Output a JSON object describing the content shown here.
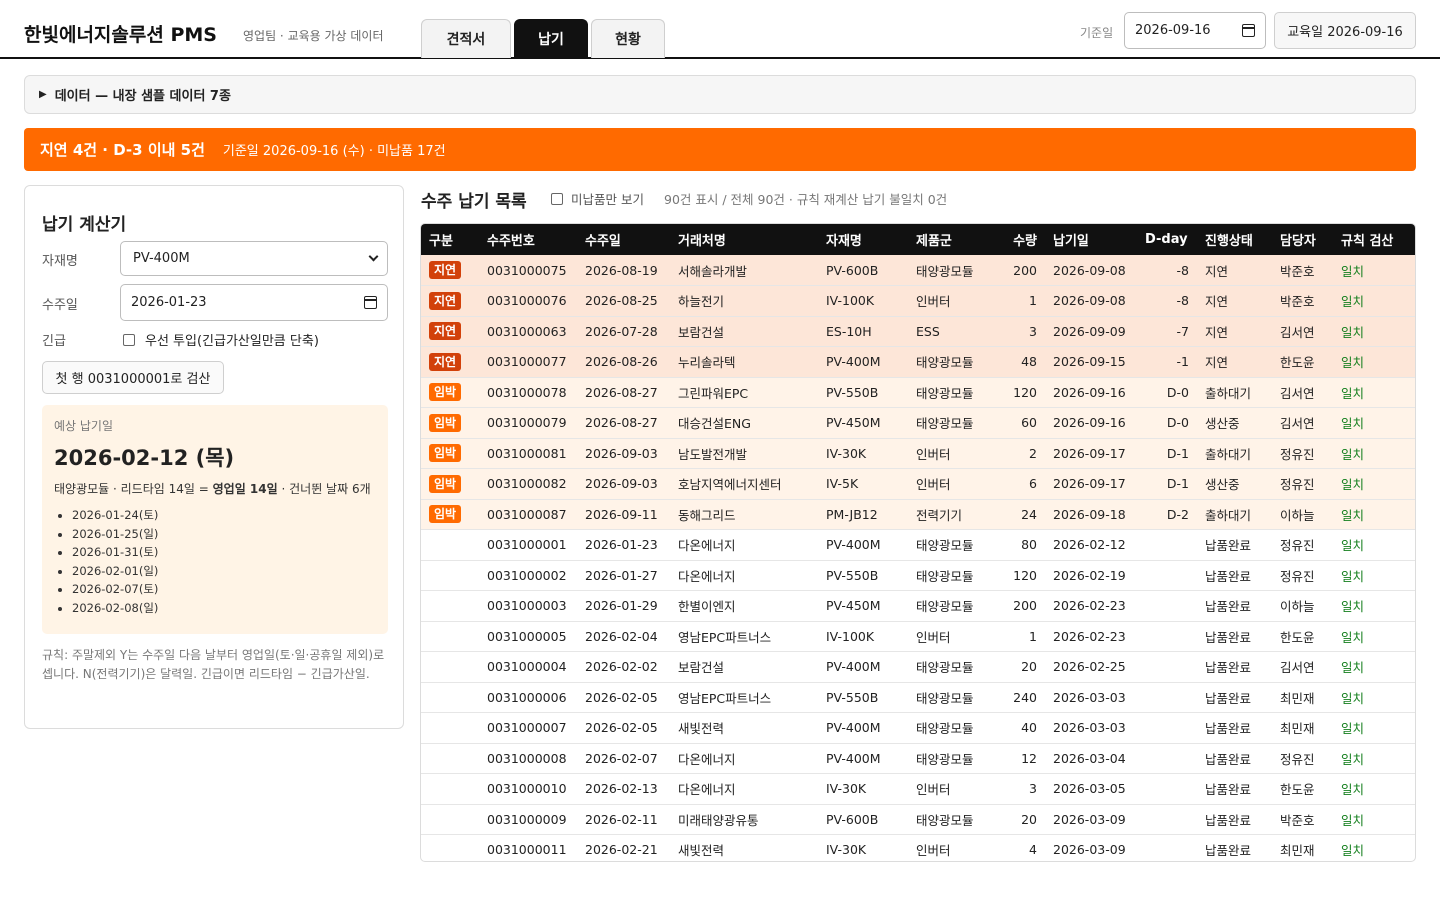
{
  "header": {
    "brand": "한빛에너지솔루션 PMS",
    "subtitle": "영업팀 · 교육용 가상 데이터",
    "tabs": [
      {
        "label": "견적서",
        "active": false
      },
      {
        "label": "납기",
        "active": true
      },
      {
        "label": "현황",
        "active": false
      }
    ],
    "base_date_label": "기준일",
    "base_date_value": "2026-09-16",
    "edu_date_button": "교육일 2026-09-16"
  },
  "data_section": {
    "label": "데이터 — 내장 샘플 데이터 7종"
  },
  "alert": {
    "main": "지연 4건 · D-3 이내 5건",
    "sub": "기준일 2026-09-16 (수) · 미납품 17건",
    "color": "#ff6a00"
  },
  "calculator": {
    "title": "납기 계산기",
    "material_label": "자재명",
    "material_value": "PV-400M",
    "order_date_label": "수주일",
    "order_date_value": "2026-01-23",
    "urgent_label": "긴급",
    "urgent_checkbox_label": "우선 투입(긴급가산일만큼 단축)",
    "check_button": "첫 행 0031000001로 검산",
    "result_label": "예상 납기일",
    "result_date": "2026-02-12 (목)",
    "result_desc_prefix": "태양광모듈 · 리드타임 14일 = ",
    "result_desc_bold": "영업일 14일",
    "result_desc_suffix": " · 건너뛴 날짜 6개",
    "skipped_dates": [
      "2026-01-24(토)",
      "2026-01-25(일)",
      "2026-01-31(토)",
      "2026-02-01(일)",
      "2026-02-07(토)",
      "2026-02-08(일)"
    ],
    "rule_text": "규칙: 주말제외 Y는 수주일 다음 날부터 영업일(토·일·공휴일 제외)로 셉니다. N(전력기기)은 달력일. 긴급이면 리드타임 − 긴급가산일."
  },
  "list": {
    "title": "수주 납기 목록",
    "filter_label": "미납품만 보기",
    "summary": "90건 표시 / 전체 90건 · 규칙 재계산 납기 불일치 0건",
    "columns": [
      "구분",
      "수주번호",
      "수주일",
      "거래처명",
      "자재명",
      "제품군",
      "수량",
      "납기일",
      "D-day",
      "진행상태",
      "담당자",
      "규칙 검산"
    ],
    "rows": [
      {
        "type": "late",
        "badge": "지연",
        "no": "0031000075",
        "order_date": "2026-08-19",
        "client": "서해솔라개발",
        "material": "PV-600B",
        "group": "태양광모듈",
        "qty": "200",
        "due": "2026-09-08",
        "dday": "-8",
        "status": "지연",
        "owner": "박준호",
        "check": "일치"
      },
      {
        "type": "late",
        "badge": "지연",
        "no": "0031000076",
        "order_date": "2026-08-25",
        "client": "하늘전기",
        "material": "IV-100K",
        "group": "인버터",
        "qty": "1",
        "due": "2026-09-08",
        "dday": "-8",
        "status": "지연",
        "owner": "박준호",
        "check": "일치"
      },
      {
        "type": "late",
        "badge": "지연",
        "no": "0031000063",
        "order_date": "2026-07-28",
        "client": "보람건설",
        "material": "ES-10H",
        "group": "ESS",
        "qty": "3",
        "due": "2026-09-09",
        "dday": "-7",
        "status": "지연",
        "owner": "김서연",
        "check": "일치"
      },
      {
        "type": "late",
        "badge": "지연",
        "no": "0031000077",
        "order_date": "2026-08-26",
        "client": "누리솔라텍",
        "material": "PV-400M",
        "group": "태양광모듈",
        "qty": "48",
        "due": "2026-09-15",
        "dday": "-1",
        "status": "지연",
        "owner": "한도윤",
        "check": "일치"
      },
      {
        "type": "soon",
        "badge": "임박",
        "no": "0031000078",
        "order_date": "2026-08-27",
        "client": "그린파워EPC",
        "material": "PV-550B",
        "group": "태양광모듈",
        "qty": "120",
        "due": "2026-09-16",
        "dday": "D-0",
        "status": "출하대기",
        "owner": "김서연",
        "check": "일치"
      },
      {
        "type": "soon",
        "badge": "임박",
        "no": "0031000079",
        "order_date": "2026-08-27",
        "client": "대승건설ENG",
        "material": "PV-450M",
        "group": "태양광모듈",
        "qty": "60",
        "due": "2026-09-16",
        "dday": "D-0",
        "status": "생산중",
        "owner": "김서연",
        "check": "일치"
      },
      {
        "type": "soon",
        "badge": "임박",
        "no": "0031000081",
        "order_date": "2026-09-03",
        "client": "남도발전개발",
        "material": "IV-30K",
        "group": "인버터",
        "qty": "2",
        "due": "2026-09-17",
        "dday": "D-1",
        "status": "출하대기",
        "owner": "정유진",
        "check": "일치"
      },
      {
        "type": "soon",
        "badge": "임박",
        "no": "0031000082",
        "order_date": "2026-09-03",
        "client": "호남지역에너지센터",
        "material": "IV-5K",
        "group": "인버터",
        "qty": "6",
        "due": "2026-09-17",
        "dday": "D-1",
        "status": "생산중",
        "owner": "정유진",
        "check": "일치"
      },
      {
        "type": "soon",
        "badge": "임박",
        "no": "0031000087",
        "order_date": "2026-09-11",
        "client": "동해그리드",
        "material": "PM-JB12",
        "group": "전력기기",
        "qty": "24",
        "due": "2026-09-18",
        "dday": "D-2",
        "status": "출하대기",
        "owner": "이하늘",
        "check": "일치"
      },
      {
        "type": "done",
        "badge": "",
        "no": "0031000001",
        "order_date": "2026-01-23",
        "client": "다온에너지",
        "material": "PV-400M",
        "group": "태양광모듈",
        "qty": "80",
        "due": "2026-02-12",
        "dday": "",
        "status": "납품완료",
        "owner": "정유진",
        "check": "일치"
      },
      {
        "type": "done",
        "badge": "",
        "no": "0031000002",
        "order_date": "2026-01-27",
        "client": "다온에너지",
        "material": "PV-550B",
        "group": "태양광모듈",
        "qty": "120",
        "due": "2026-02-19",
        "dday": "",
        "status": "납품완료",
        "owner": "정유진",
        "check": "일치"
      },
      {
        "type": "done",
        "badge": "",
        "no": "0031000003",
        "order_date": "2026-01-29",
        "client": "한별이엔지",
        "material": "PV-450M",
        "group": "태양광모듈",
        "qty": "200",
        "due": "2026-02-23",
        "dday": "",
        "status": "납품완료",
        "owner": "이하늘",
        "check": "일치"
      },
      {
        "type": "done",
        "badge": "",
        "no": "0031000005",
        "order_date": "2026-02-04",
        "client": "영남EPC파트너스",
        "material": "IV-100K",
        "group": "인버터",
        "qty": "1",
        "due": "2026-02-23",
        "dday": "",
        "status": "납품완료",
        "owner": "한도윤",
        "check": "일치"
      },
      {
        "type": "done",
        "badge": "",
        "no": "0031000004",
        "order_date": "2026-02-02",
        "client": "보람건설",
        "material": "PV-400M",
        "group": "태양광모듈",
        "qty": "20",
        "due": "2026-02-25",
        "dday": "",
        "status": "납품완료",
        "owner": "김서연",
        "check": "일치"
      },
      {
        "type": "done",
        "badge": "",
        "no": "0031000006",
        "order_date": "2026-02-05",
        "client": "영남EPC파트너스",
        "material": "PV-550B",
        "group": "태양광모듈",
        "qty": "240",
        "due": "2026-03-03",
        "dday": "",
        "status": "납품완료",
        "owner": "최민재",
        "check": "일치"
      },
      {
        "type": "done",
        "badge": "",
        "no": "0031000007",
        "order_date": "2026-02-05",
        "client": "새빛전력",
        "material": "PV-400M",
        "group": "태양광모듈",
        "qty": "40",
        "due": "2026-03-03",
        "dday": "",
        "status": "납품완료",
        "owner": "최민재",
        "check": "일치"
      },
      {
        "type": "done",
        "badge": "",
        "no": "0031000008",
        "order_date": "2026-02-07",
        "client": "다온에너지",
        "material": "PV-400M",
        "group": "태양광모듈",
        "qty": "12",
        "due": "2026-03-04",
        "dday": "",
        "status": "납품완료",
        "owner": "정유진",
        "check": "일치"
      },
      {
        "type": "done",
        "badge": "",
        "no": "0031000010",
        "order_date": "2026-02-13",
        "client": "다온에너지",
        "material": "IV-30K",
        "group": "인버터",
        "qty": "3",
        "due": "2026-03-05",
        "dday": "",
        "status": "납품완료",
        "owner": "한도윤",
        "check": "일치"
      },
      {
        "type": "done",
        "badge": "",
        "no": "0031000009",
        "order_date": "2026-02-11",
        "client": "미래태양광유통",
        "material": "PV-600B",
        "group": "태양광모듈",
        "qty": "20",
        "due": "2026-03-09",
        "dday": "",
        "status": "납품완료",
        "owner": "박준호",
        "check": "일치"
      },
      {
        "type": "done",
        "badge": "",
        "no": "0031000011",
        "order_date": "2026-02-21",
        "client": "새빛전력",
        "material": "IV-30K",
        "group": "인버터",
        "qty": "4",
        "due": "2026-03-09",
        "dday": "",
        "status": "납품완료",
        "owner": "최민재",
        "check": "일치"
      }
    ]
  }
}
